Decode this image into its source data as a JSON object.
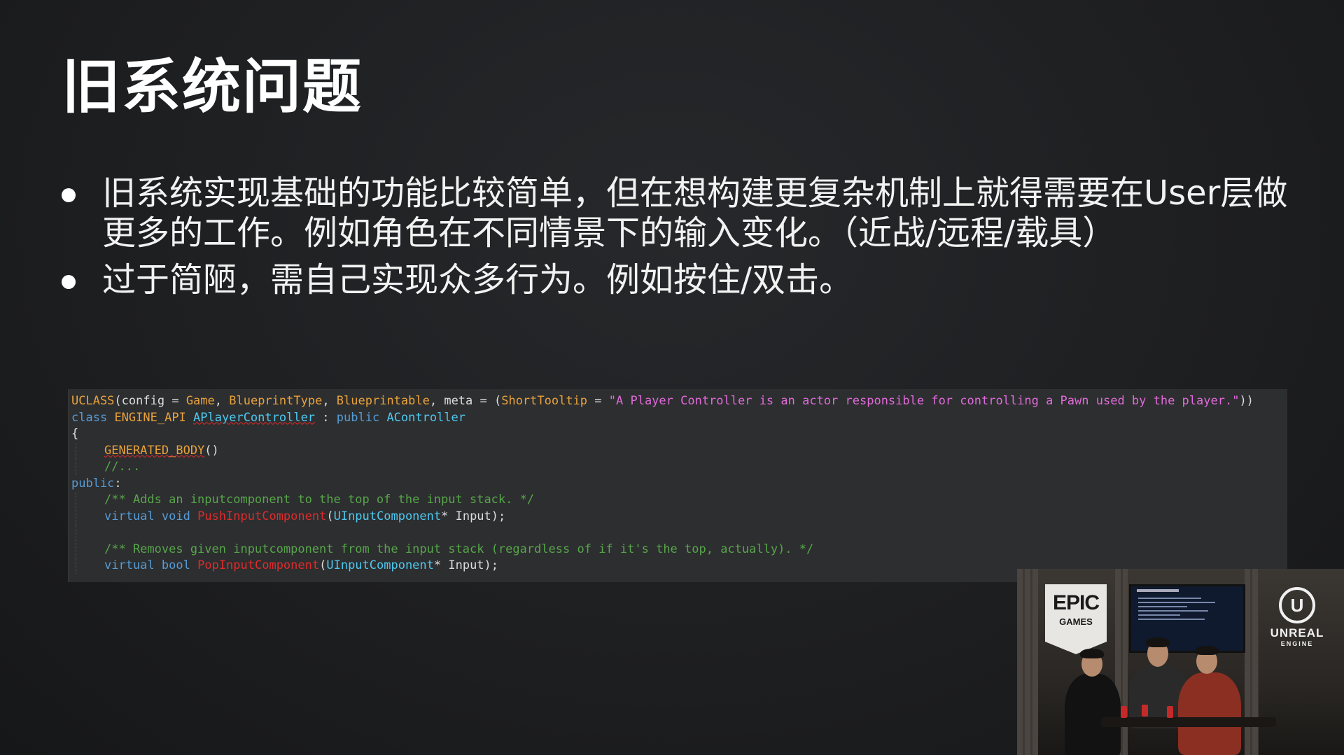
{
  "slide": {
    "title": "旧系统问题",
    "bullets": [
      {
        "lines": [
          "旧系统实现基础的功能比较简单，但在想构建更复杂机制上就得需要在User层做",
          "更多的工作。例如角色在不同情景下的输入变化。（近战/远程/载具）"
        ]
      },
      {
        "lines": [
          "过于简陋，需自己实现众多行为。例如按住/双击。"
        ]
      }
    ]
  },
  "code": {
    "line1": {
      "uclass": "UCLASS",
      "open": "(",
      "config": "config",
      "eq1": " = ",
      "game": "Game",
      "c1": ", ",
      "bptype": "BlueprintType",
      "c2": ", ",
      "bpable": "Blueprintable",
      "c3": ", meta = (",
      "tooltip": "ShortTooltip",
      "eq2": " = ",
      "str": "\"A Player Controller is an actor responsible for controlling a Pawn used by the player.\"",
      "close": "))"
    },
    "line2": {
      "cls": "class",
      "api": "ENGINE_API",
      "name": "APlayerController",
      "colon": " : ",
      "pub": "public",
      "base": "AController"
    },
    "line3": "{",
    "line4": {
      "macro": "GENERATED_BODY",
      "paren": "()"
    },
    "line5": "//...",
    "line6": {
      "kw": "public",
      "colon": ":"
    },
    "line7": "/** Adds an inputcomponent to the top of the input stack. */",
    "line8": {
      "virt": "virtual",
      "ret": "void",
      "fn": "PushInputComponent",
      "open": "(",
      "type": "UInputComponent",
      "rest": "* Input);"
    },
    "line10": "/** Removes given inputcomponent from the input stack (regardless of if it's the top, actually). */",
    "line11": {
      "virt": "virtual",
      "ret": "bool",
      "fn": "PopInputComponent",
      "open": "(",
      "type": "UInputComponent",
      "rest": "* Input);"
    }
  },
  "video": {
    "epic_big": "EPIC",
    "epic_small": "GAMES",
    "ue_mark": "U",
    "ue_word1": "UNREAL",
    "ue_word2": "ENGINE"
  }
}
